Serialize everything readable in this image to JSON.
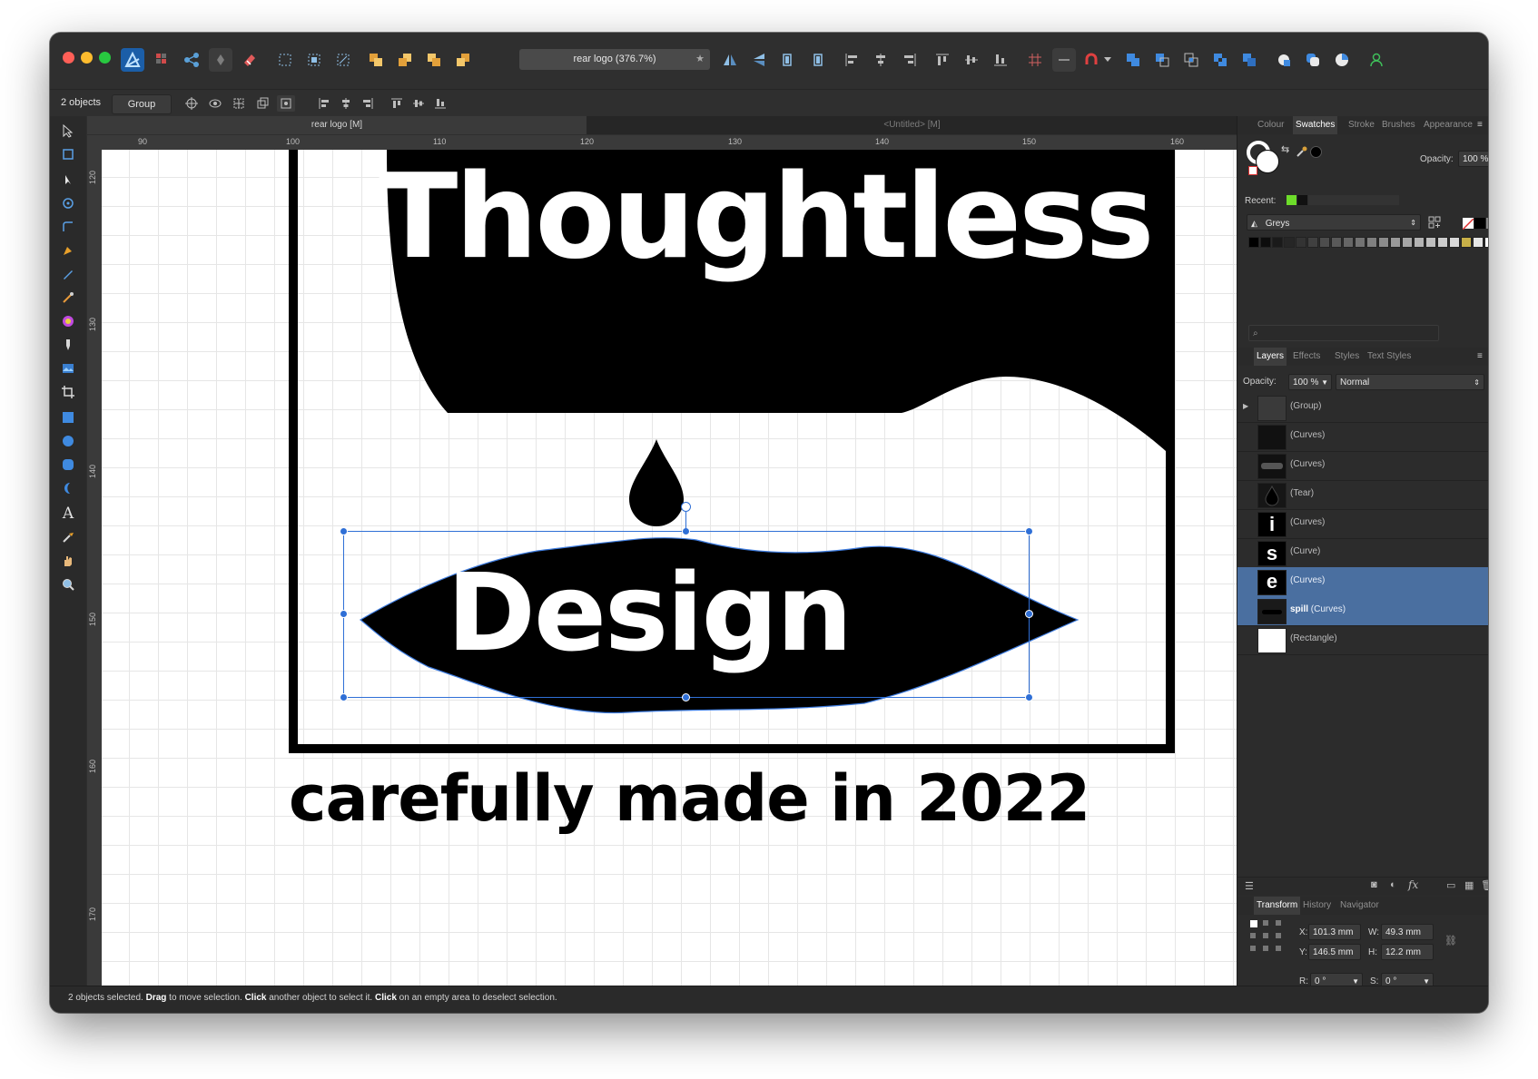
{
  "document": {
    "title": "rear logo (376.7%)",
    "tabs": [
      "rear logo [M]",
      "<Untitled> [M]"
    ]
  },
  "context_toolbar": {
    "selection_count": "2 objects",
    "group_button": "Group"
  },
  "ruler": {
    "h_marks": [
      "90",
      "100",
      "110",
      "120",
      "130",
      "140",
      "150",
      "160"
    ],
    "v_marks": [
      "120",
      "130",
      "140",
      "150",
      "160",
      "170"
    ]
  },
  "artwork": {
    "title": "Thoughtless",
    "word": "Design",
    "tagline": "carefully made in 2022"
  },
  "colour_panel": {
    "tabs": [
      "Colour",
      "Swatches",
      "Stroke",
      "Brushes",
      "Appearance"
    ],
    "active_tab": "Swatches",
    "opacity_label": "Opacity:",
    "opacity_value": "100 %",
    "recent_label": "Recent:",
    "palette_name": "Greys",
    "search_placeholder": ""
  },
  "layers_panel": {
    "tabs": [
      "Layers",
      "Effects",
      "Styles",
      "Text Styles"
    ],
    "active_tab": "Layers",
    "opacity_label": "Opacity:",
    "opacity_value": "100 %",
    "blend_mode": "Normal",
    "layers": [
      {
        "name": "(Group)",
        "selected": false,
        "expandable": true
      },
      {
        "name": "(Curves)",
        "selected": false
      },
      {
        "name": "(Curves)",
        "selected": false
      },
      {
        "name": "(Tear)",
        "selected": false
      },
      {
        "name": "(Curves)",
        "selected": false
      },
      {
        "name": "(Curve)",
        "selected": false
      },
      {
        "name": "(Curves)",
        "selected": true
      },
      {
        "name": "(Curves)",
        "bold_prefix": "spill",
        "selected": true
      },
      {
        "name": "(Rectangle)",
        "selected": false
      }
    ]
  },
  "transform_panel": {
    "tabs": [
      "Transform",
      "History",
      "Navigator"
    ],
    "active_tab": "Transform",
    "x_label": "X:",
    "x_value": "101.3 mm",
    "y_label": "Y:",
    "y_value": "146.5 mm",
    "w_label": "W:",
    "w_value": "49.3 mm",
    "h_label": "H:",
    "h_value": "12.2 mm",
    "r_label": "R:",
    "r_value": "0 °",
    "s_label": "S:",
    "s_value": "0 °"
  },
  "status_bar": {
    "p1": "2 objects selected. ",
    "b1": "Drag",
    "p2": " to move selection. ",
    "b2": "Click",
    "p3": " another object to select it. ",
    "b3": "Click",
    "p4": " on an empty area to deselect selection."
  },
  "colors": {
    "accent": "#4a6fa0",
    "selection": "#2f6fd6",
    "recent_green": "#6ddc2a"
  }
}
